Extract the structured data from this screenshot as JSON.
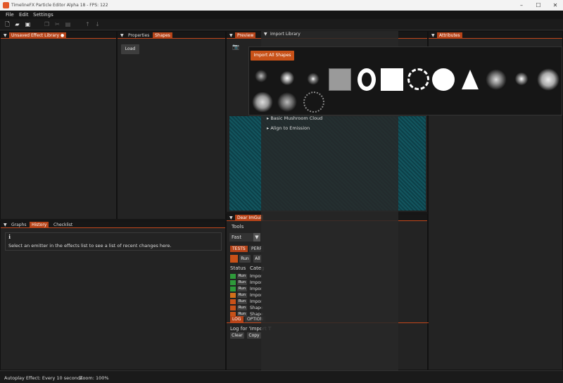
{
  "window": {
    "title": "TimelineFX Particle Editor Alpha 18 - FPS: 122"
  },
  "menu": [
    "File",
    "Edit",
    "Settings"
  ],
  "tabs": {
    "library": "Unsaved Effect Library",
    "properties": "Properties",
    "shapes": "Shapes",
    "preview": "Preview",
    "import_library": "Import Library",
    "attributes": "Attributes",
    "graphs": "Graphs",
    "history": "History",
    "checklist": "Checklist",
    "dear_imgui": "Dear ImGui",
    "tests": "TESTS",
    "perf": "PERF",
    "log": "LOG",
    "options": "OPTION"
  },
  "shapes_panel": {
    "load_label": "Load"
  },
  "import_popup": {
    "import_all_label": "Import All Shapes"
  },
  "import_list": [
    "Basic Mushroom Cloud",
    "Align to Emission"
  ],
  "history": {
    "message": "Select an emitter in the effects list to see a list of recent changes here."
  },
  "imgui": {
    "tools_label": "Tools",
    "speed_value": "Fast",
    "run_label": "Run",
    "all_label": "All",
    "col_status": "Status",
    "col_category": "Categ",
    "rows": [
      {
        "color": "#2e9a3a",
        "run": "Run",
        "cat": "Impor"
      },
      {
        "color": "#2e9a3a",
        "run": "Run",
        "cat": "Impor"
      },
      {
        "color": "#2e9a3a",
        "run": "Run",
        "cat": "Impor"
      },
      {
        "color": "#d2701a",
        "run": "Run",
        "cat": "Impor"
      },
      {
        "color": "#c85118",
        "run": "Run",
        "cat": "Impor"
      },
      {
        "color": "#c85118",
        "run": "Run",
        "cat": "Shape"
      },
      {
        "color": "#c85118",
        "run": "Run",
        "cat": "Shape"
      }
    ],
    "log_for": "Log for 'Import T",
    "clear_label": "Clear",
    "copy_label": "Copy"
  },
  "status": {
    "autoplay": "Autoplay Effect: Every 10 seconds",
    "zoom": "Zoom: 100%"
  },
  "colors": {
    "accent": "#c85118",
    "panel": "#232323",
    "preview_bg": "#0e4a55"
  },
  "icons": [
    "new-file-icon",
    "open-folder-icon",
    "save-icon",
    "copy-icon",
    "cut-icon",
    "paste-icon",
    "arrow-up-icon",
    "arrow-down-icon",
    "camera-icon",
    "info-icon"
  ]
}
